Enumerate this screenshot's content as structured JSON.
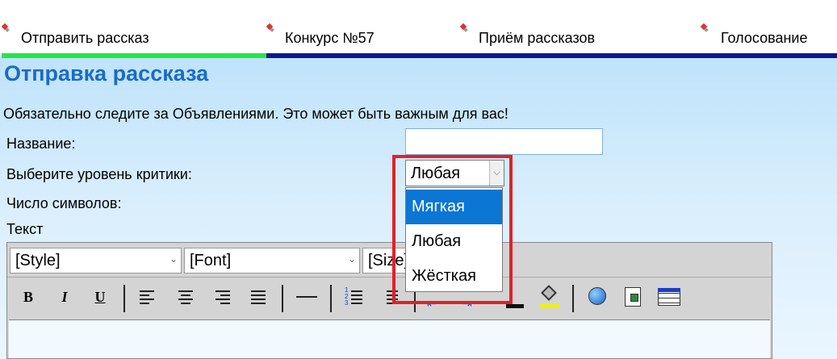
{
  "nav": {
    "items": [
      {
        "label": "Отправить рассказ"
      },
      {
        "label": "Конкурс №57"
      },
      {
        "label": "Приём рассказов"
      },
      {
        "label": "Голосование"
      }
    ],
    "active_bar_color": "#22e64a",
    "bar_color": "#0a1a8c"
  },
  "page": {
    "title": "Отправка рассказа",
    "notice": "Обязательно следите за Объявлениями. Это может быть важным для вас!"
  },
  "form": {
    "name_label": "Название:",
    "name_value": "",
    "criticism_label": "Выберите уровень критики:",
    "criticism_selected": "Любая",
    "criticism_options": [
      "Мягкая",
      "Любая",
      "Жёсткая"
    ],
    "char_count_label": "Число символов:",
    "text_label": "Текст"
  },
  "editor": {
    "style_combo": "[Style]",
    "font_combo": "[Font]",
    "size_combo": "[Size]",
    "bold": "B",
    "italic": "I",
    "underline": "U"
  },
  "colors": {
    "title": "#1a6cc6",
    "highlight": "#e02228",
    "option_selected": "#0b76d4"
  }
}
